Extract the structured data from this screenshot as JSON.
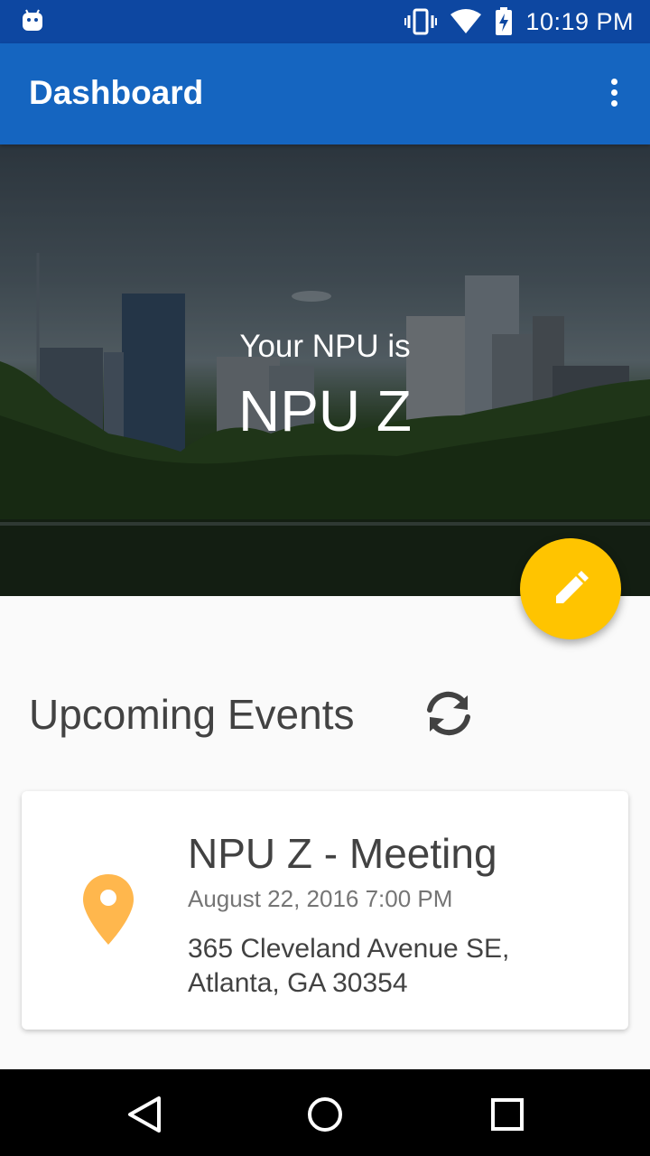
{
  "status_bar": {
    "time": "10:19 PM",
    "icons": [
      "android-icon",
      "vibrate-icon",
      "wifi-icon",
      "battery-charging-icon"
    ]
  },
  "app_bar": {
    "title": "Dashboard",
    "menu_icon": "more-vert-icon"
  },
  "hero": {
    "subtitle": "Your NPU is",
    "npu": "NPU Z"
  },
  "fab": {
    "icon": "edit-pencil-icon",
    "color": "#ffc400"
  },
  "events_section": {
    "title": "Upcoming Events",
    "refresh_icon": "refresh-icon"
  },
  "events": [
    {
      "title": "NPU Z - Meeting",
      "date": "August 22, 2016 7:00 PM",
      "address_line1": "365 Cleveland Avenue SE,",
      "address_line2": "Atlanta, GA 30354",
      "icon": "location-pin-icon",
      "icon_color": "#ffb74d"
    }
  ],
  "nav_bar": {
    "buttons": [
      "back-icon",
      "home-icon",
      "recents-icon"
    ]
  },
  "colors": {
    "status_bar": "#0d47a1",
    "app_bar": "#1565c0",
    "accent": "#ffc400"
  }
}
